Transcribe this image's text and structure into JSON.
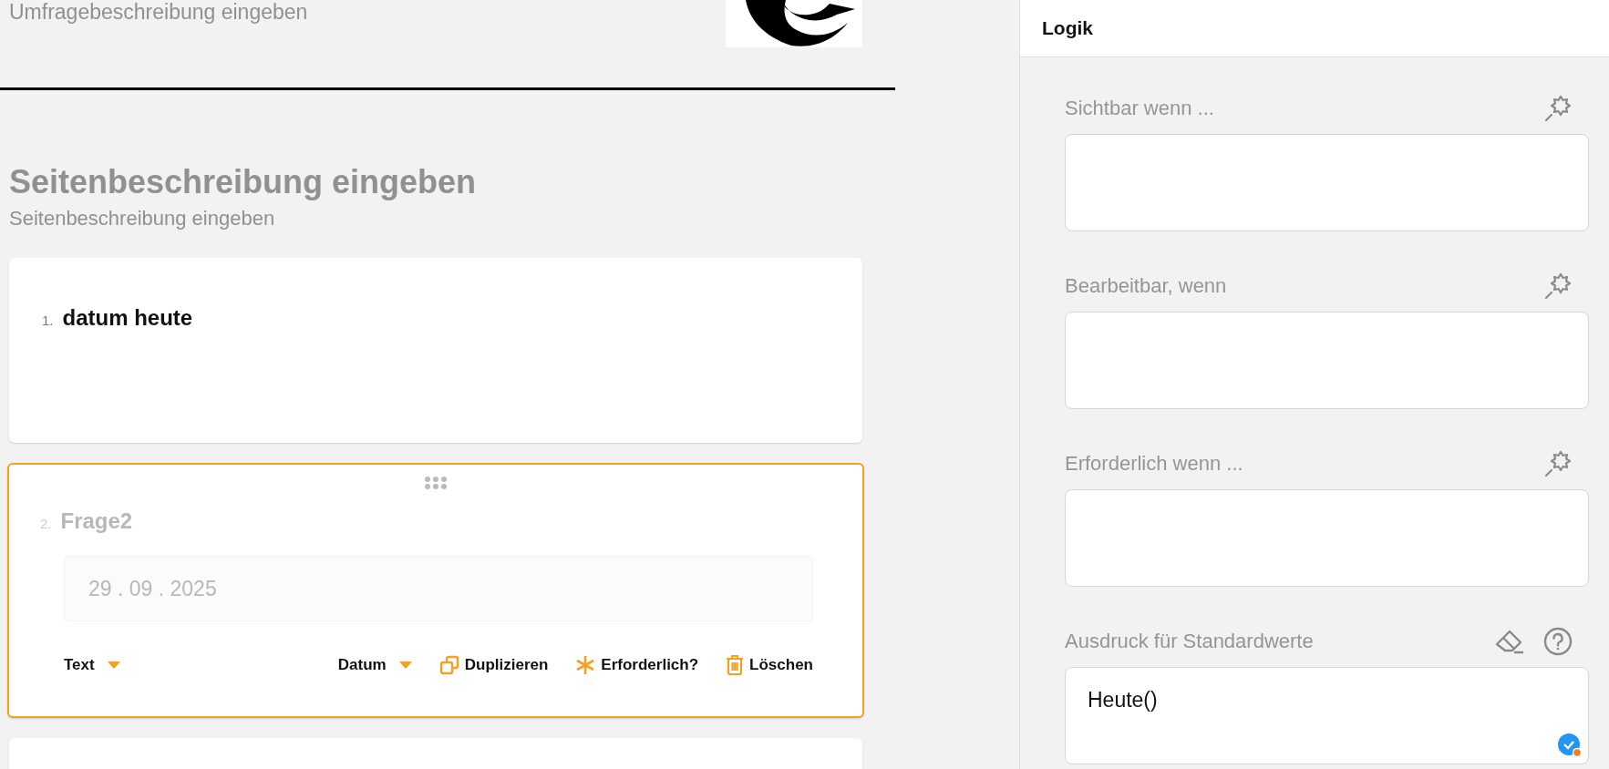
{
  "survey": {
    "description": "Umfragebeschreibung eingeben"
  },
  "page": {
    "title": "Seitenbeschreibung eingeben",
    "description": "Seitenbeschreibung eingeben"
  },
  "questions": [
    {
      "number": "1.",
      "title": "datum heute",
      "selected": false,
      "readonly": false
    },
    {
      "number": "2.",
      "title": "Frage2",
      "selected": true,
      "readonly": true,
      "input_value": "29 . 09 . 2025",
      "toolbar": [
        {
          "kind": "dropdown",
          "label": "Text"
        },
        {
          "kind": "dropdown",
          "label": "Datum"
        },
        {
          "kind": "duplicate",
          "label": "Duplizieren"
        },
        {
          "kind": "required",
          "label": "Erforderlich?"
        },
        {
          "kind": "delete",
          "label": "Löschen"
        }
      ]
    },
    {
      "selected": false
    }
  ],
  "panel": {
    "title": "Logik",
    "fields": [
      {
        "label": "Sichtbar wenn ...",
        "tools": [
          {
            "kind": "wand"
          }
        ]
      },
      {
        "label": "Bearbeitbar, wenn",
        "tools": [
          {
            "kind": "wand"
          }
        ]
      },
      {
        "label": "Erforderlich wenn ...",
        "tools": [
          {
            "kind": "wand"
          }
        ]
      },
      {
        "label": "Ausdruck für Standardwerte",
        "tools": [
          {
            "kind": "eraser"
          },
          {
            "kind": "help"
          }
        ],
        "value": "Heute()",
        "validated": true
      }
    ]
  }
}
